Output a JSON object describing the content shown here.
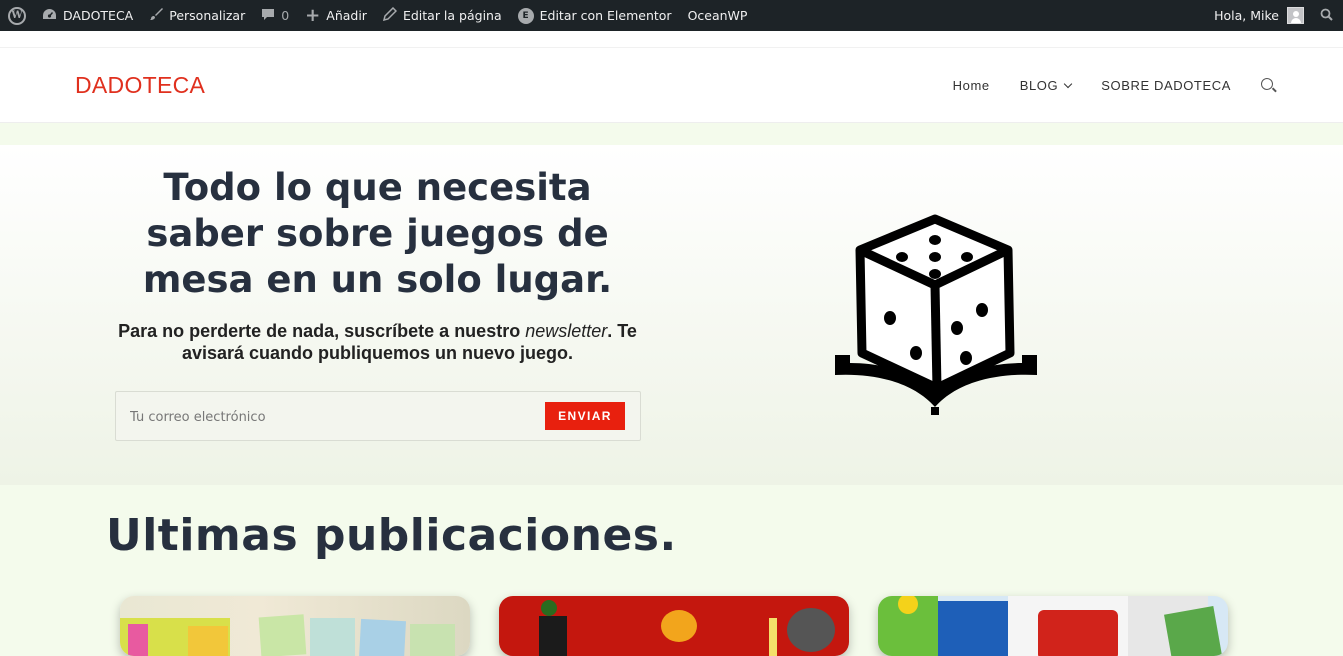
{
  "admin_bar": {
    "site_name": "DADOTECA",
    "customize": "Personalizar",
    "comments_count": "0",
    "add_new": "Añadir",
    "edit_page": "Editar la página",
    "edit_elementor": "Editar con Elementor",
    "oceanwp": "OceanWP",
    "greeting": "Hola, Mike"
  },
  "header": {
    "logo": "DADOTECA",
    "nav": [
      "Home",
      "BLOG",
      "SOBRE DADOTECA"
    ]
  },
  "hero": {
    "title": "Todo lo que necesita saber sobre juegos de mesa en un solo lugar.",
    "subtitle_pre": "Para no perderte de nada, suscríbete a nuestro ",
    "subtitle_em": "newsletter",
    "subtitle_post": ". Te avisará cuando publiquemos un nuevo juego.",
    "email_placeholder": "Tu correo electrónico",
    "submit_label": "ENVIAR"
  },
  "posts": {
    "title": "Ultimas publicaciones."
  },
  "colors": {
    "brand_red": "#e0301e",
    "button_red": "#e8200e",
    "heading": "#27303f",
    "admin_bar": "#1d2327"
  },
  "icons": [
    "wordpress-logo-icon",
    "dashboard-icon",
    "brush-icon",
    "comment-icon",
    "plus-icon",
    "pencil-icon",
    "elementor-icon",
    "avatar-icon",
    "search-icon",
    "chevron-down-icon",
    "dice-book-icon"
  ]
}
